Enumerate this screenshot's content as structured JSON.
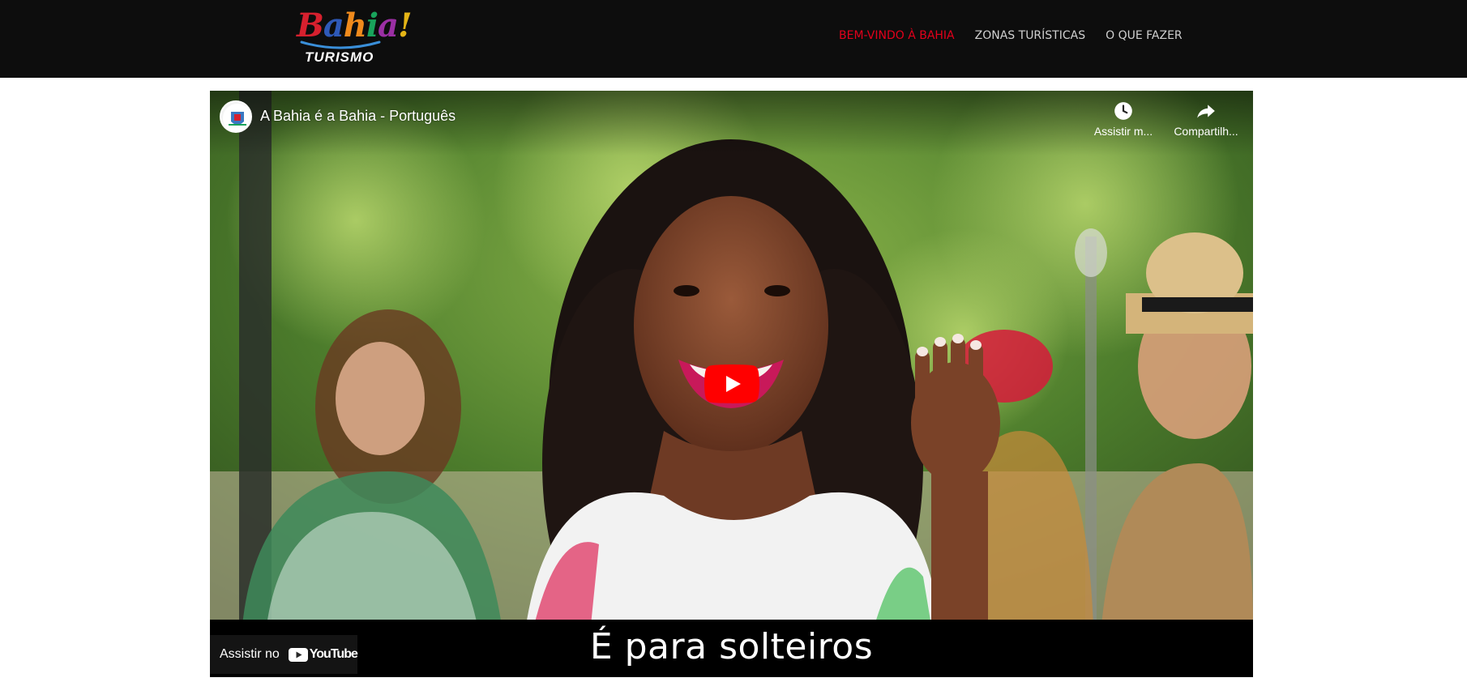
{
  "logo": {
    "word_letters": [
      "B",
      "a",
      "h",
      "i",
      "a",
      "!"
    ],
    "word_colors": [
      "#d6202e",
      "#2e59b8",
      "#f08a1c",
      "#19a35b",
      "#9b2fa3",
      "#e4b416"
    ],
    "subtitle": "TURISMO",
    "arc_color": "#3a8fd9"
  },
  "nav": {
    "items": [
      {
        "label": "BEM-VINDO À BAHIA",
        "active": true
      },
      {
        "label": "ZONAS TURÍSTICAS",
        "active": false
      },
      {
        "label": "O QUE FAZER",
        "active": false
      }
    ],
    "active_color": "#e3001b"
  },
  "video": {
    "title": "A Bahia é a Bahia - Português",
    "watch_later_label": "Assistir m...",
    "share_label": "Compartilh...",
    "watch_later_icon": "clock-icon",
    "share_icon": "share-arrow-icon",
    "play_icon": "youtube-play-icon",
    "subtitle": "É para solteiros",
    "watch_on_label": "Assistir no",
    "youtube_wordmark": "YouTube",
    "youtube_red": "#ff0000"
  }
}
